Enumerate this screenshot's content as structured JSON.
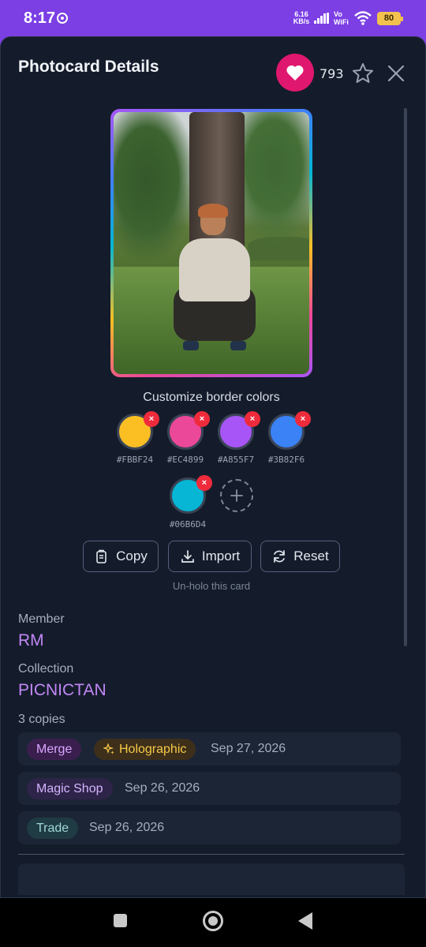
{
  "status_bar": {
    "time": "8:17",
    "net_speed": "6.16",
    "net_unit": "KB/s",
    "vowifi_top": "Vo",
    "vowifi_bottom": "WiFi",
    "battery": "80"
  },
  "header": {
    "title": "Photocard Details",
    "like_count": "793",
    "like_icon": "heart-icon",
    "favorite_icon": "star-icon",
    "close_icon": "close-icon"
  },
  "card": {
    "border_gradient": [
      "#A855F7",
      "#3B82F6",
      "#06B6D4",
      "#FBBF24",
      "#EC4899"
    ]
  },
  "border_colors": {
    "label": "Customize border colors",
    "remove_symbol": "×",
    "swatches": [
      {
        "hex": "#FBBF24",
        "color": "#FBBF24"
      },
      {
        "hex": "#EC4899",
        "color": "#EC4899"
      },
      {
        "hex": "#A855F7",
        "color": "#A855F7"
      },
      {
        "hex": "#3B82F6",
        "color": "#3B82F6"
      },
      {
        "hex": "#06B6D4",
        "color": "#06B6D4"
      }
    ]
  },
  "actions": {
    "copy": "Copy",
    "import": "Import",
    "reset": "Reset",
    "unholo": "Un-holo this card"
  },
  "details": {
    "member_label": "Member",
    "member_value": "RM",
    "collection_label": "Collection",
    "collection_value": "PICNICTAN",
    "copies_label": "3 copies"
  },
  "copies": [
    {
      "tags": [
        "Merge",
        "Holographic"
      ],
      "date": "Sep 27, 2026"
    },
    {
      "tags": [
        "Magic Shop"
      ],
      "date": "Sep 26, 2026"
    },
    {
      "tags": [
        "Trade"
      ],
      "date": "Sep 26, 2026"
    }
  ],
  "colors": {
    "accent_purple": "#c287f5",
    "like_pink": "#e0176e",
    "status_purple": "#7b3fe4",
    "sheet_bg": "#141c2b"
  }
}
